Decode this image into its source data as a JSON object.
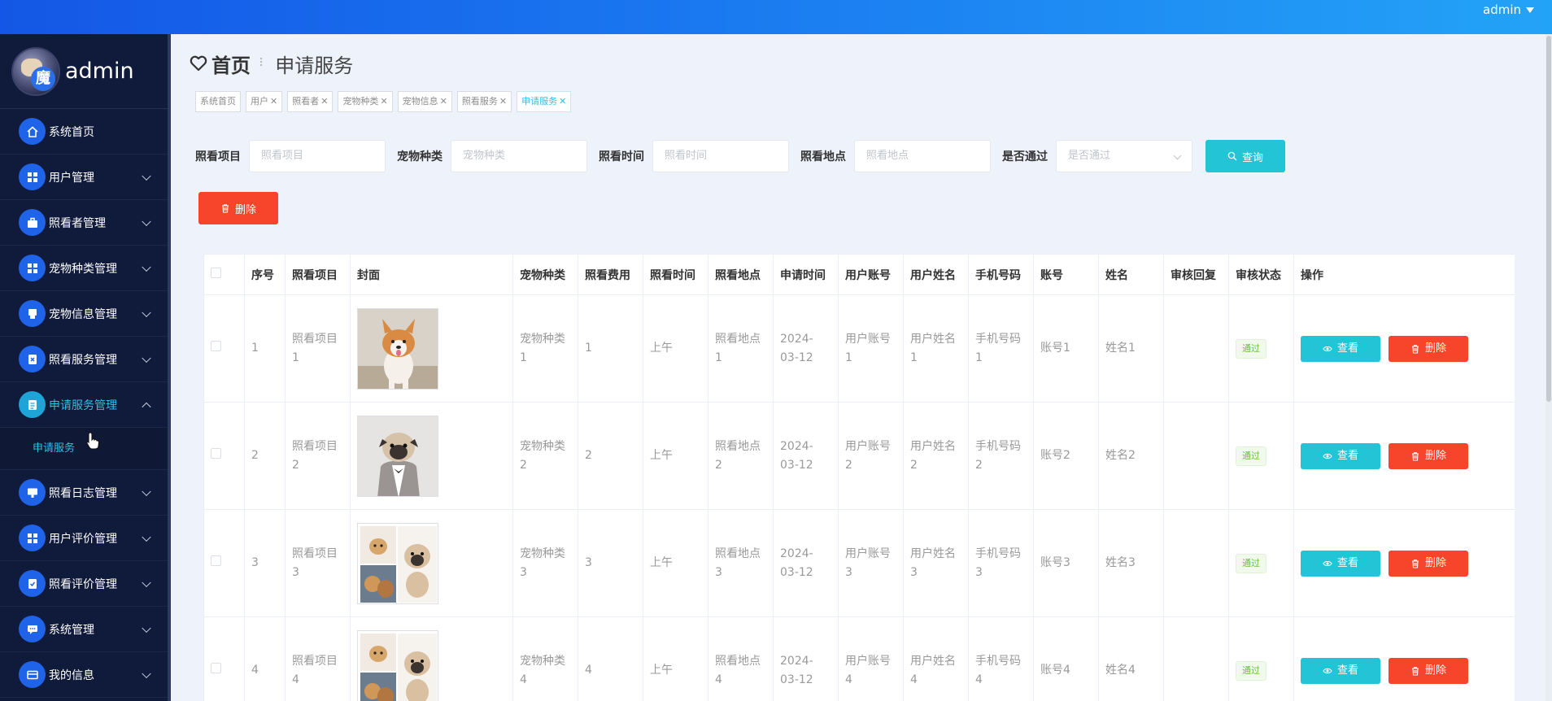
{
  "header": {
    "user": "admin"
  },
  "sidebar": {
    "brand_name": "admin",
    "items": [
      {
        "label": "系统首页",
        "icon": "home-icon",
        "chevron": false
      },
      {
        "label": "用户管理",
        "icon": "grid-icon",
        "chevron": true
      },
      {
        "label": "照看者管理",
        "icon": "briefcase-icon",
        "chevron": true
      },
      {
        "label": "宠物种类管理",
        "icon": "grid-icon",
        "chevron": true
      },
      {
        "label": "宠物信息管理",
        "icon": "printer-icon",
        "chevron": true
      },
      {
        "label": "照看服务管理",
        "icon": "clipboard-x-icon",
        "chevron": true
      },
      {
        "label": "申请服务管理",
        "icon": "document-icon",
        "chevron": true,
        "active": true
      }
    ],
    "subitem": "申请服务",
    "items_after": [
      {
        "label": "照看日志管理",
        "icon": "monitor-icon",
        "chevron": true
      },
      {
        "label": "用户评价管理",
        "icon": "grid-icon",
        "chevron": true
      },
      {
        "label": "照看评价管理",
        "icon": "clipboard-check-icon",
        "chevron": true
      },
      {
        "label": "系统管理",
        "icon": "chat-icon",
        "chevron": true
      },
      {
        "label": "我的信息",
        "icon": "card-icon",
        "chevron": true
      }
    ]
  },
  "breadcrumb": {
    "home": "首页",
    "current": "申请服务"
  },
  "tabs": [
    "系统首页",
    "用户",
    "照看者",
    "宠物种类",
    "宠物信息",
    "照看服务",
    "申请服务"
  ],
  "search": {
    "fields": [
      {
        "label": "照看项目",
        "placeholder": "照看项目"
      },
      {
        "label": "宠物种类",
        "placeholder": "宠物种类"
      },
      {
        "label": "照看时间",
        "placeholder": "照看时间"
      },
      {
        "label": "照看地点",
        "placeholder": "照看地点"
      },
      {
        "label": "是否通过",
        "placeholder": "是否通过",
        "select": true
      }
    ],
    "query_label": "查询"
  },
  "delete_label": "删除",
  "table": {
    "headers": [
      "序号",
      "照看项目",
      "封面",
      "宠物种类",
      "照看费用",
      "照看时间",
      "照看地点",
      "申请时间",
      "用户账号",
      "用户姓名",
      "手机号码",
      "账号",
      "姓名",
      "审核回复",
      "审核状态",
      "操作"
    ],
    "rows": [
      {
        "no": "1",
        "item": "照看项目1",
        "cover": "corgi",
        "kind": "宠物种类1",
        "fee": "1",
        "time": "上午",
        "place": "照看地点1",
        "apply": "2024-03-12",
        "account": "用户账号1",
        "uname": "用户姓名1",
        "phone": "手机号码1",
        "acc": "账号1",
        "name": "姓名1",
        "reply": "",
        "status": "通过"
      },
      {
        "no": "2",
        "item": "照看项目2",
        "cover": "pug",
        "kind": "宠物种类2",
        "fee": "2",
        "time": "上午",
        "place": "照看地点2",
        "apply": "2024-03-12",
        "account": "用户账号2",
        "uname": "用户姓名2",
        "phone": "手机号码2",
        "acc": "账号2",
        "name": "姓名2",
        "reply": "",
        "status": "通过"
      },
      {
        "no": "3",
        "item": "照看项目3",
        "cover": "collage",
        "kind": "宠物种类3",
        "fee": "3",
        "time": "上午",
        "place": "照看地点3",
        "apply": "2024-03-12",
        "account": "用户账号3",
        "uname": "用户姓名3",
        "phone": "手机号码3",
        "acc": "账号3",
        "name": "姓名3",
        "reply": "",
        "status": "通过"
      },
      {
        "no": "4",
        "item": "照看项目4",
        "cover": "collage",
        "kind": "宠物种类4",
        "fee": "4",
        "time": "上午",
        "place": "照看地点4",
        "apply": "2024-03-12",
        "account": "用户账号4",
        "uname": "用户姓名4",
        "phone": "手机号码4",
        "acc": "账号4",
        "name": "姓名4",
        "reply": "",
        "status": "通过"
      }
    ],
    "view_label": "查看",
    "delete_label": "删除"
  },
  "colors": {
    "primary": "#1f64e8",
    "accent": "#22c4d6",
    "danger": "#f6452a",
    "success": "#67c23a",
    "sidebar_bg": "#101a3a"
  }
}
